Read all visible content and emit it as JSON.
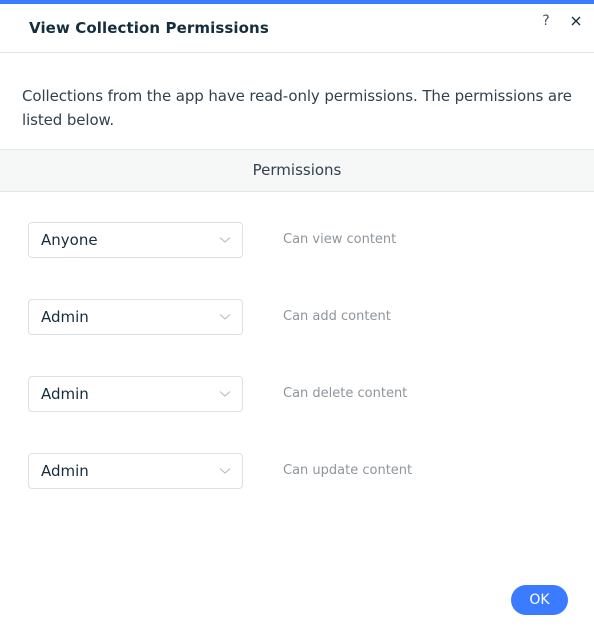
{
  "dialog": {
    "title": "View Collection Permissions",
    "help_icon": "help-icon",
    "close_icon": "close-icon",
    "accent_color": "#3b7bff"
  },
  "description": "Collections from the app have read-only permissions. The permissions are listed below.",
  "section": {
    "header": "Permissions"
  },
  "permissions": [
    {
      "role": "Anyone",
      "action": "Can view content"
    },
    {
      "role": "Admin",
      "action": "Can add content"
    },
    {
      "role": "Admin",
      "action": "Can delete content"
    },
    {
      "role": "Admin",
      "action": "Can update content"
    }
  ],
  "footer": {
    "ok_label": "OK"
  }
}
